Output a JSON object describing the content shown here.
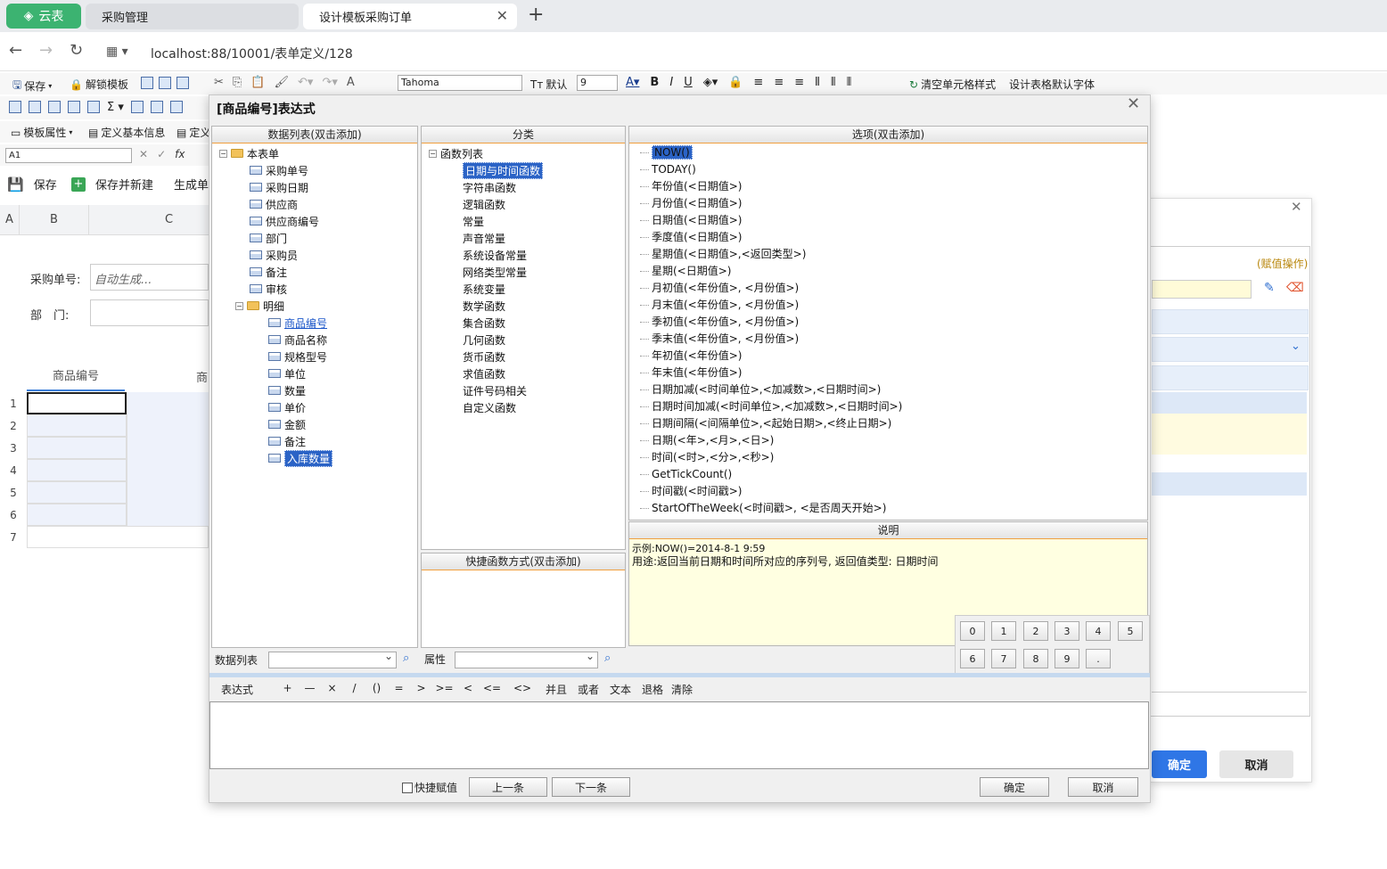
{
  "browser": {
    "home_tab": "云表",
    "tabs": [
      "采购管理",
      "设计模板采购订单"
    ],
    "url": "localhost:88/10001/表单定义/128"
  },
  "toolbar1": {
    "save": "保存",
    "unlock": "解锁模板",
    "font": "Tahoma",
    "font_default": "默认",
    "font_size": "9",
    "clear_style": "清空单元格样式",
    "default_font": "设计表格默认字体"
  },
  "toolbar3": {
    "template_props": "模板属性",
    "basic_info": "定义基本信息",
    "define_short": "定义"
  },
  "toolbar4": {
    "cell_ref": "A1"
  },
  "actionbar": {
    "save": "保存",
    "save_new": "保存并新建",
    "generate": "生成单"
  },
  "sheet": {
    "cols": [
      "A",
      "B",
      "C"
    ],
    "fields": [
      {
        "label": "采购单号:",
        "value": "自动生成..."
      },
      {
        "label": "部　门:",
        "value": ""
      }
    ],
    "grid_header": "商品编号",
    "grid_header2": "商",
    "rows": [
      "1",
      "2",
      "3",
      "4",
      "5",
      "6",
      "7"
    ]
  },
  "bg_dialog": {
    "assign_op": "(赋值操作)",
    "ok": "确定",
    "cancel": "取消"
  },
  "dialog": {
    "title": "[商品编号]表达式",
    "data_panel": {
      "header": "数据列表(双击添加)",
      "root": "本表单",
      "fields": [
        "采购单号",
        "采购日期",
        "供应商",
        "供应商编号",
        "部门",
        "采购员",
        "备注",
        "审核"
      ],
      "detail_folder": "明细",
      "detail_fields": [
        "商品编号",
        "商品名称",
        "规格型号",
        "单位",
        "数量",
        "单价",
        "金额",
        "备注",
        "入库数量"
      ]
    },
    "category_panel": {
      "header": "分类",
      "root": "函数列表",
      "items": [
        "日期与时间函数",
        "字符串函数",
        "逻辑函数",
        "常量",
        "声音常量",
        "系统设备常量",
        "网络类型常量",
        "系统变量",
        "数学函数",
        "集合函数",
        "几何函数",
        "货币函数",
        "求值函数",
        "证件号码相关",
        "自定义函数"
      ]
    },
    "shortcut_panel": {
      "header": "快捷函数方式(双击添加)"
    },
    "options_panel": {
      "header": "选项(双击添加)",
      "items": [
        "NOW()",
        "TODAY()",
        "年份值(<日期值>)",
        "月份值(<日期值>)",
        "日期值(<日期值>)",
        "季度值(<日期值>)",
        "星期值(<日期值>,<返回类型>)",
        "星期(<日期值>)",
        "月初值(<年份值>, <月份值>)",
        "月末值(<年份值>, <月份值>)",
        "季初值(<年份值>, <月份值>)",
        "季末值(<年份值>, <月份值>)",
        "年初值(<年份值>)",
        "年末值(<年份值>)",
        "日期加减(<时间单位>,<加减数>,<日期时间>)",
        "日期时间加减(<时间单位>,<加减数>,<日期时间>)",
        "日期间隔(<间隔单位>,<起始日期>,<终止日期>)",
        "日期(<年>,<月>,<日>)",
        "时间(<时>,<分>,<秒>)",
        "GetTickCount()",
        "时间戳(<时间戳>)",
        "StartOfTheWeek(<时间戳>, <是否周天开始>)"
      ]
    },
    "desc_panel": {
      "header": "说明",
      "example": "示例:NOW()=2014-8-1 9:59",
      "usage": "用途:返回当前日期和时间所对应的序列号, 返回值类型: 日期时间"
    },
    "numpad": [
      "0",
      "1",
      "2",
      "3",
      "4",
      "5",
      "6",
      "7",
      "8",
      "9",
      "."
    ],
    "filter": {
      "data_list_label": "数据列表",
      "attr_label": "属性"
    },
    "ops": [
      "表达式",
      "+",
      "—",
      "×",
      "/",
      "()",
      "=",
      ">",
      ">=",
      "<",
      "<=",
      "<>",
      "并且",
      "或者",
      "文本",
      "退格",
      "清除"
    ],
    "footer": {
      "quick_assign": "快捷赋值",
      "prev": "上一条",
      "next": "下一条",
      "ok": "确定",
      "cancel": "取消"
    }
  }
}
